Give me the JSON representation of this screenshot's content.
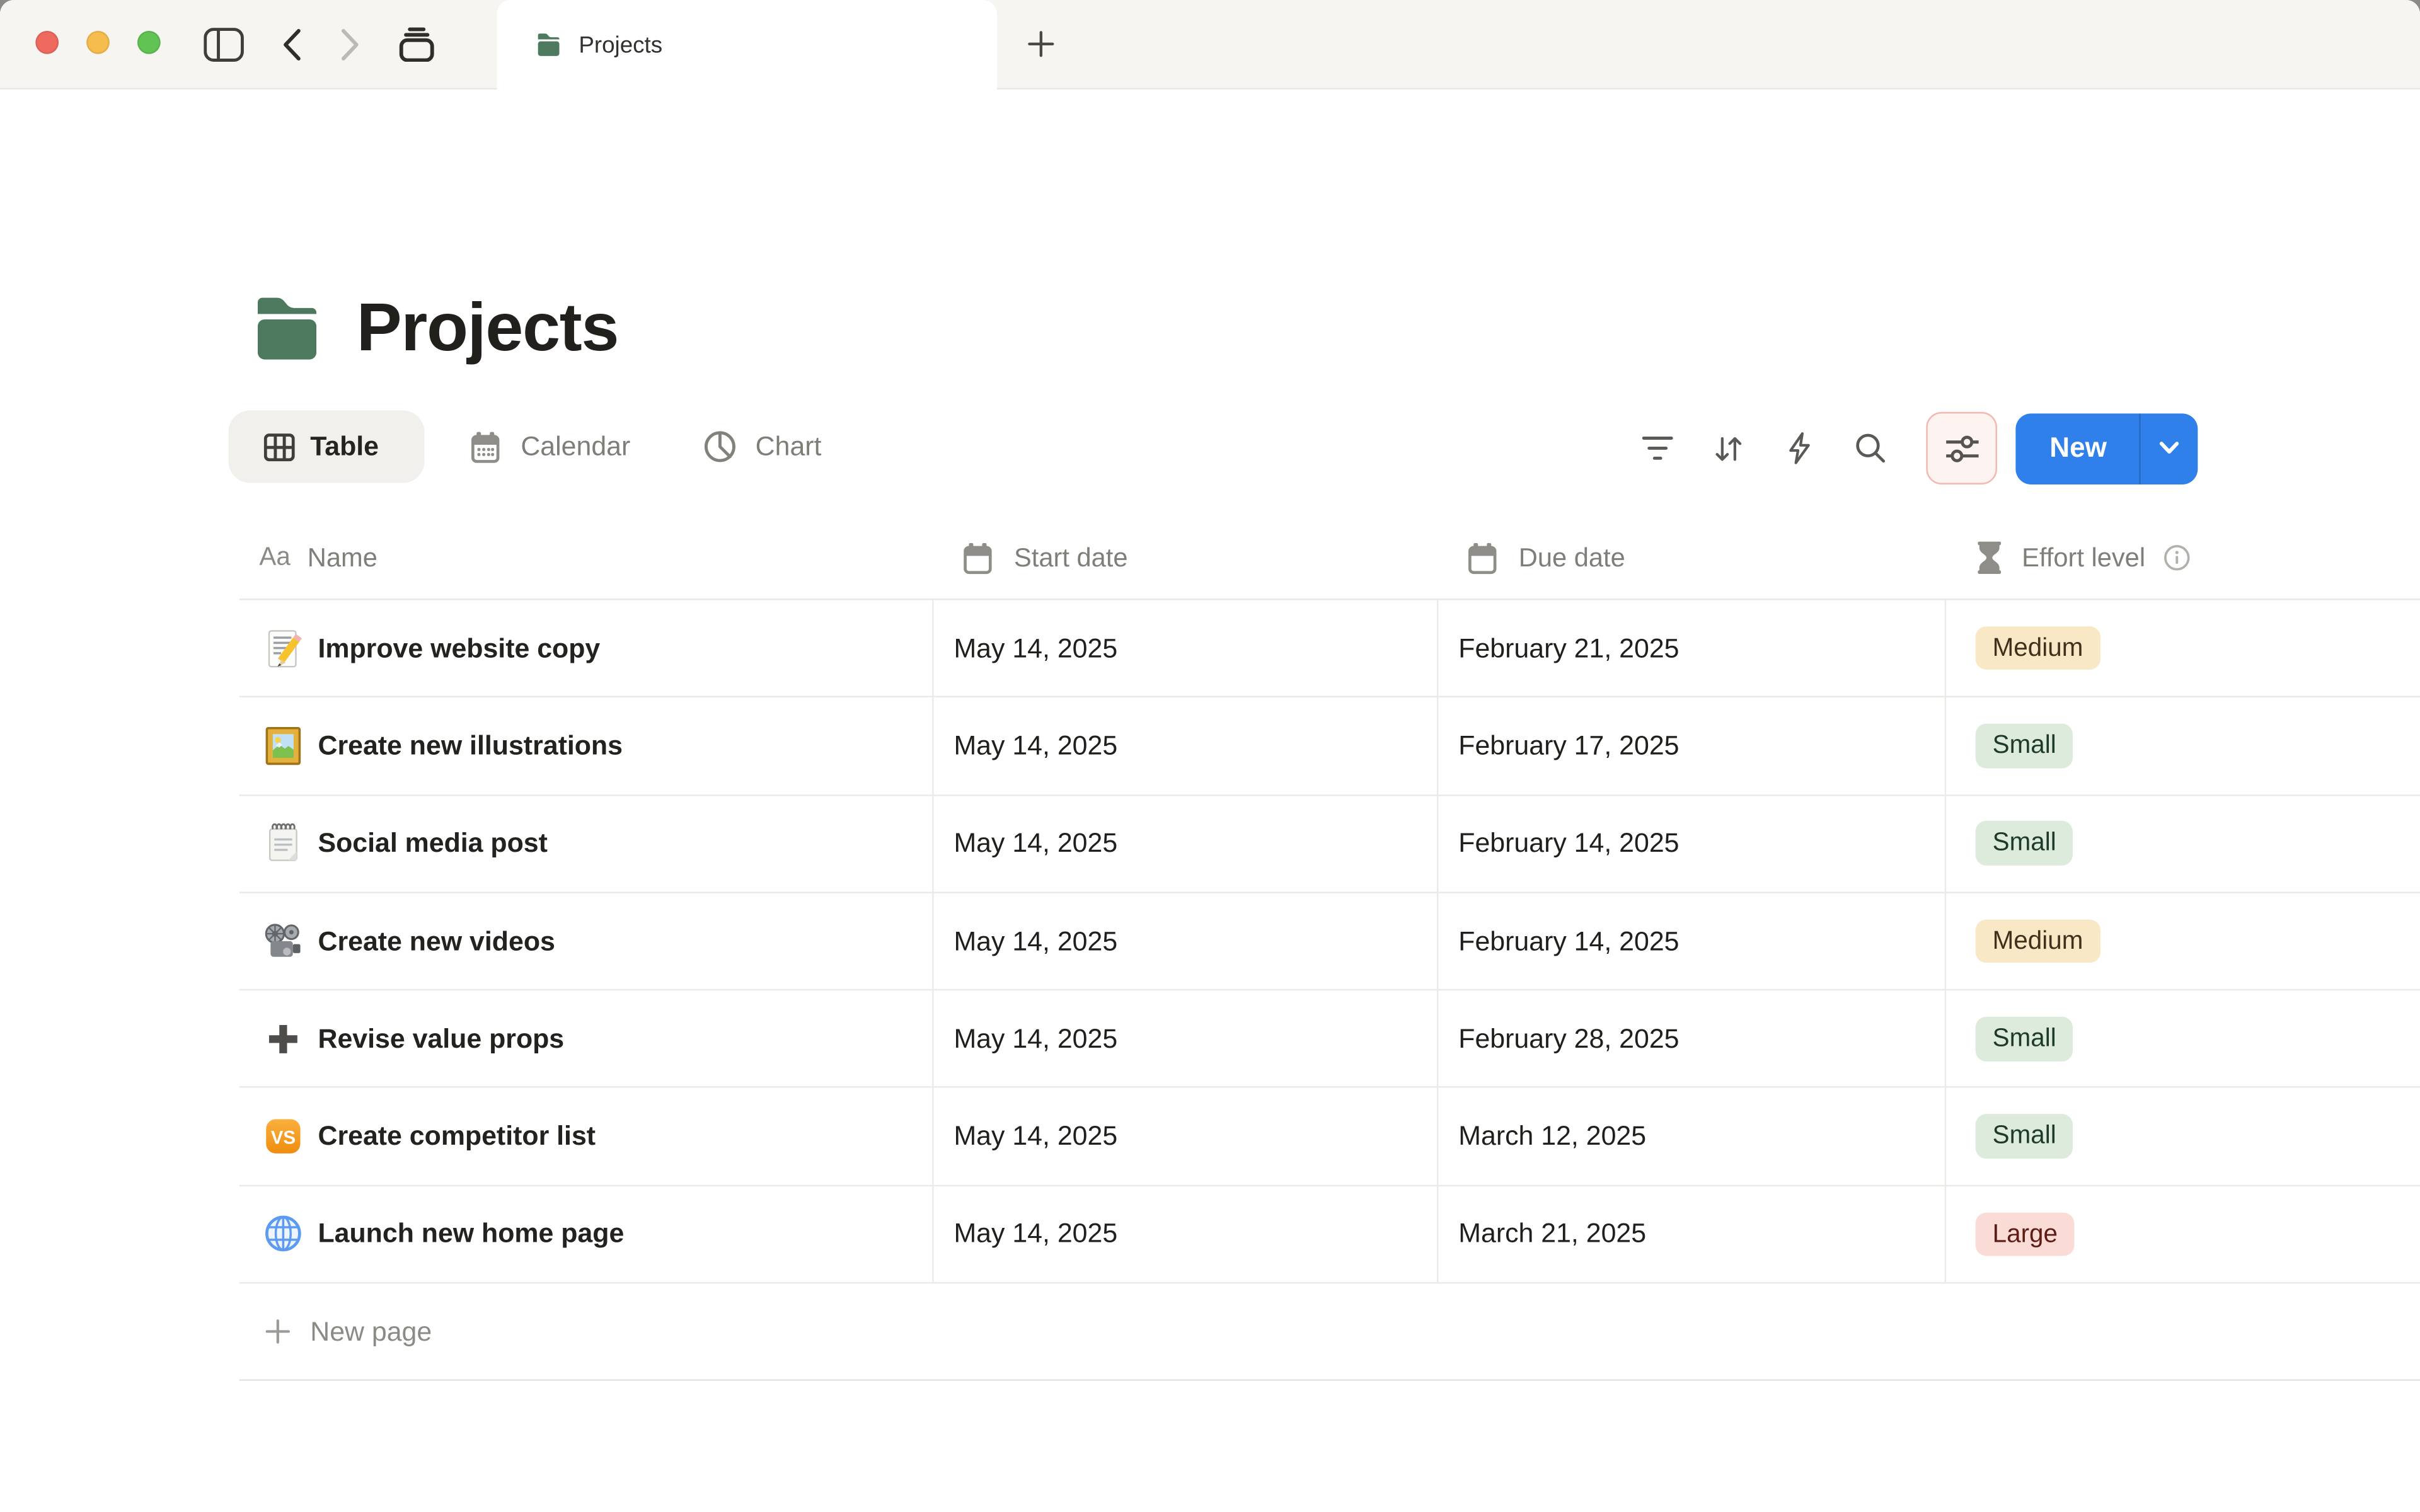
{
  "tabbar": {
    "tab_title": "Projects",
    "icons": [
      "traffic-close",
      "traffic-minimize",
      "traffic-zoom",
      "sidebar-toggle-icon",
      "back-chevron-icon",
      "forward-chevron-icon",
      "tabs-stack-icon",
      "folder-icon",
      "new-tab-plus-icon"
    ]
  },
  "page": {
    "title": "Projects"
  },
  "views": {
    "table_label": "Table",
    "calendar_label": "Calendar",
    "chart_label": "Chart",
    "icons": [
      "table-grid-icon",
      "calendar-icon",
      "pie-chart-icon"
    ]
  },
  "toolbar": {
    "new_label": "New",
    "icons": [
      "filter-icon",
      "sort-icon",
      "automation-lightning-icon",
      "search-icon",
      "view-options-sliders-icon",
      "chevron-down-icon"
    ]
  },
  "table": {
    "headers": {
      "name": "Name",
      "start": "Start date",
      "due": "Due date",
      "effort": "Effort level"
    },
    "header_icons": [
      "aa-text-icon",
      "calendar-icon",
      "calendar-icon",
      "hourglass-icon",
      "info-icon"
    ],
    "rows": [
      {
        "icon": "memo-icon",
        "name": "Improve website copy",
        "start": "May 14, 2025",
        "due": "February 21, 2025",
        "effort": "Medium",
        "effort_style": "yellow"
      },
      {
        "icon": "framed-picture-icon",
        "name": "Create new illustrations",
        "start": "May 14, 2025",
        "due": "February 17, 2025",
        "effort": "Small",
        "effort_style": "green"
      },
      {
        "icon": "spiral-notepad-icon",
        "name": "Social media post",
        "start": "May 14, 2025",
        "due": "February 14, 2025",
        "effort": "Small",
        "effort_style": "green"
      },
      {
        "icon": "movie-camera-icon",
        "name": "Create new videos",
        "start": "May 14, 2025",
        "due": "February 14, 2025",
        "effort": "Medium",
        "effort_style": "yellow"
      },
      {
        "icon": "plus-emoji-icon",
        "name": "Revise value props",
        "start": "May 14, 2025",
        "due": "February 28, 2025",
        "effort": "Small",
        "effort_style": "green"
      },
      {
        "icon": "vs-emoji-icon",
        "name": "Create competitor list",
        "start": "May 14, 2025",
        "due": "March 12, 2025",
        "effort": "Small",
        "effort_style": "green"
      },
      {
        "icon": "globe-icon",
        "name": "Launch new home page",
        "start": "May 14, 2025",
        "due": "March 21, 2025",
        "effort": "Large",
        "effort_style": "red"
      }
    ],
    "new_page_label": "New page"
  },
  "colors": {
    "accent_blue": "#2f80ea",
    "folder_green": "#4d7a5f",
    "badge_yellow_bg": "#f9e8c5",
    "badge_green_bg": "#dcebdc",
    "badge_red_bg": "#fadbd6",
    "options_highlight_border": "#f3b8b0",
    "options_highlight_bg": "#fdf3f1",
    "traffic_red": "#ee6a5f",
    "traffic_yellow": "#f5bd4e",
    "traffic_green": "#61c354",
    "tabbar_bg": "#f6f5f2"
  }
}
